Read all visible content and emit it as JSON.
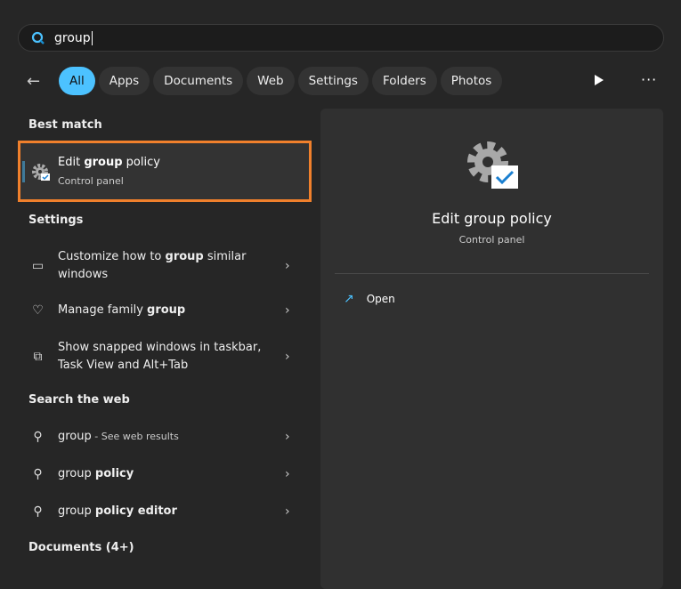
{
  "search": {
    "query": "group"
  },
  "filters": {
    "back": "←",
    "items": [
      "All",
      "Apps",
      "Documents",
      "Web",
      "Settings",
      "Folders",
      "Photos"
    ],
    "active": "All",
    "more": "···"
  },
  "best_match": {
    "header": "Best match",
    "title_pre": "Edit ",
    "title_bold": "group",
    "title_post": " policy",
    "subtitle": "Control panel"
  },
  "settings": {
    "header": "Settings",
    "items": [
      {
        "pre": "Customize how to ",
        "bold": "group",
        "post": " similar windows",
        "icon": "monitor-icon"
      },
      {
        "pre": "Manage family ",
        "bold": "group",
        "post": "",
        "icon": "heart-family-icon"
      },
      {
        "pre": "Show snapped windows in taskbar, Task View and Alt+Tab",
        "bold": "",
        "post": "",
        "icon": "snap-windows-icon"
      }
    ]
  },
  "web": {
    "header": "Search the web",
    "items": [
      {
        "pre": "group",
        "bold": "",
        "post": " - See web results"
      },
      {
        "pre": "group ",
        "bold": "policy",
        "post": ""
      },
      {
        "pre": "group ",
        "bold": "policy editor",
        "post": ""
      }
    ]
  },
  "documents": {
    "header": "Documents (4+)"
  },
  "preview": {
    "title": "Edit group policy",
    "subtitle": "Control panel",
    "action": "Open"
  },
  "colors": {
    "accent": "#4cc2ff",
    "highlight": "#f0802c"
  }
}
